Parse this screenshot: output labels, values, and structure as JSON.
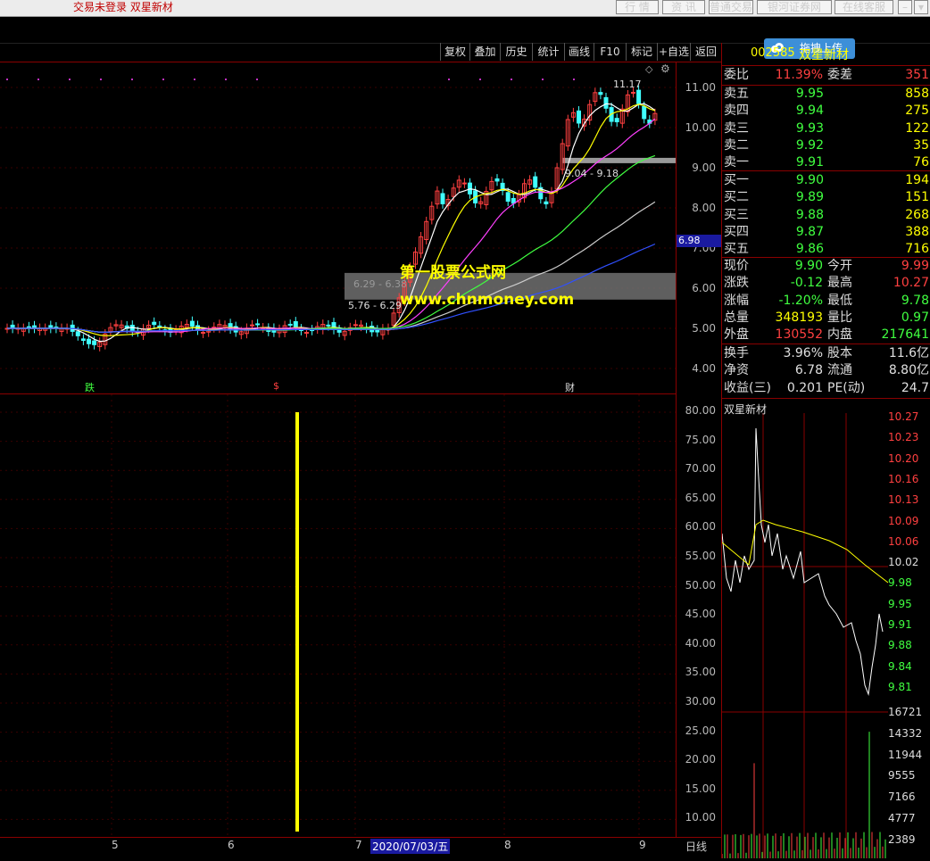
{
  "window": {
    "title": "交易未登录  双星新材",
    "buttons": [
      "行 情",
      "资 讯",
      "普通交易",
      "银河证券网",
      "在线客服"
    ]
  },
  "upload_button": "拖拽上传",
  "menu": [
    "复权",
    "叠加",
    "历史",
    "统计",
    "画线",
    "F10",
    "标记",
    "+自选",
    "返回"
  ],
  "main_chart": {
    "price_ticks": [
      "11.00",
      "10.00",
      "9.00",
      "8.00",
      "7.00",
      "6.00",
      "5.00",
      "4.00"
    ],
    "highlight_price": "6.98",
    "high_label": "11.17",
    "zone_labels": [
      "9.04 - 9.18",
      "6.29 - 6.38",
      "5.76 - 6.29"
    ],
    "markers": [
      "跌",
      "$",
      "财"
    ],
    "watermark_cn": "第一股票公式网",
    "watermark_url": "www.chnmoney.com"
  },
  "lower_chart": {
    "ticks": [
      "80.00",
      "75.00",
      "70.00",
      "65.00",
      "60.00",
      "55.00",
      "50.00",
      "45.00",
      "40.00",
      "35.00",
      "30.00",
      "25.00",
      "20.00",
      "15.00",
      "10.00"
    ]
  },
  "x_axis": {
    "labels": [
      "5",
      "6",
      "7",
      "2020/07/03/五",
      "8",
      "9"
    ],
    "period": "日线"
  },
  "quote": {
    "code": "002585",
    "name": "双星新材",
    "ratio": {
      "label": "委比",
      "value": "11.39%",
      "label2": "委差",
      "value2": "351"
    },
    "asks": [
      {
        "label": "卖五",
        "price": "9.95",
        "vol": "858"
      },
      {
        "label": "卖四",
        "price": "9.94",
        "vol": "275"
      },
      {
        "label": "卖三",
        "price": "9.93",
        "vol": "122"
      },
      {
        "label": "卖二",
        "price": "9.92",
        "vol": "35"
      },
      {
        "label": "卖一",
        "price": "9.91",
        "vol": "76"
      }
    ],
    "bids": [
      {
        "label": "买一",
        "price": "9.90",
        "vol": "194"
      },
      {
        "label": "买二",
        "price": "9.89",
        "vol": "151"
      },
      {
        "label": "买三",
        "price": "9.88",
        "vol": "268"
      },
      {
        "label": "买四",
        "price": "9.87",
        "vol": "388"
      },
      {
        "label": "买五",
        "price": "9.86",
        "vol": "716"
      }
    ],
    "stats": [
      {
        "k": "现价",
        "v": "9.90",
        "k2": "今开",
        "v2": "9.99"
      },
      {
        "k": "涨跌",
        "v": "-0.12",
        "k2": "最高",
        "v2": "10.27"
      },
      {
        "k": "涨幅",
        "v": "-1.20%",
        "k2": "最低",
        "v2": "9.78"
      },
      {
        "k": "总量",
        "v": "348193",
        "k2": "量比",
        "v2": "0.97"
      },
      {
        "k": "外盘",
        "v": "130552",
        "k2": "内盘",
        "v2": "217641"
      }
    ],
    "stats2": [
      {
        "k": "换手",
        "v": "3.96%",
        "k2": "股本",
        "v2": "11.6亿"
      },
      {
        "k": "净资",
        "v": "6.78",
        "k2": "流通",
        "v2": "8.80亿"
      },
      {
        "k": "收益(三)",
        "v": "0.201",
        "k2": "PE(动)",
        "v2": "24.7"
      }
    ]
  },
  "intraday": {
    "title": "双星新材",
    "price_ticks": [
      "10.27",
      "10.23",
      "10.20",
      "10.16",
      "10.13",
      "10.09",
      "10.06",
      "10.02",
      "9.98",
      "9.95",
      "9.91",
      "9.88",
      "9.84",
      "9.81"
    ],
    "volume_ticks": [
      "16721",
      "14332",
      "11944",
      "9555",
      "7166",
      "4777",
      "2389"
    ]
  },
  "colors": {
    "up": "#ff4040",
    "down": "#40ff40",
    "grid": "#8a0000",
    "price_line": "#ffffff",
    "avg_line": "#ffff00"
  }
}
